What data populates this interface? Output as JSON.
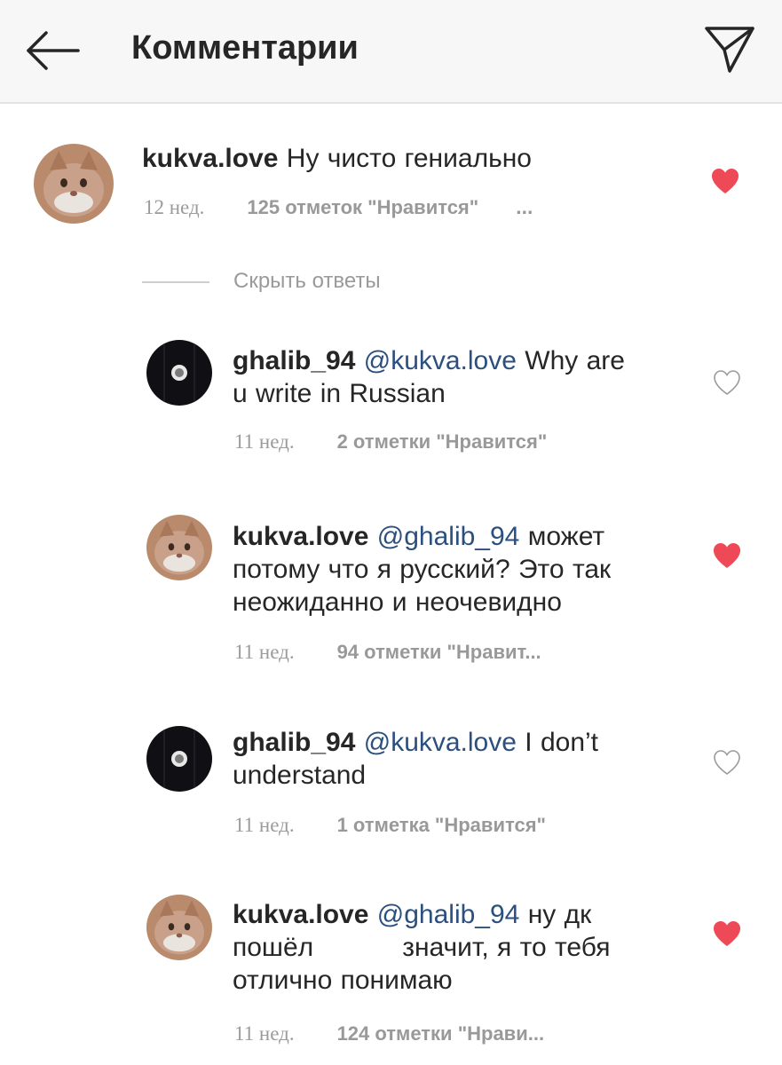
{
  "header": {
    "title": "Комментарии"
  },
  "colors": {
    "liked_heart": "#ed4956",
    "mention": "#2b4f7e",
    "meta": "#9b9b9b"
  },
  "main_comment": {
    "username": "kukva.love",
    "text": "Ну чисто гениально",
    "time": "12 нед.",
    "likes": "125 отметок \"Нравится\"",
    "more": "...",
    "liked": true
  },
  "hide_replies": "Скрыть ответы",
  "replies": [
    {
      "username": "ghalib_94",
      "mention": "@kukva.love",
      "line1_rest": "Why are",
      "line2": "u write in Russian",
      "time": "11 нед.",
      "likes": "2 отметки \"Нравится\"",
      "liked": false
    },
    {
      "username": "kukva.love",
      "mention": "@ghalib_94",
      "line1_rest": "может",
      "line2": "потому что я русский? Это так",
      "line3": "неожиданно и неочевидно",
      "time": "11 нед.",
      "likes": "94 отметки \"Нравит...",
      "liked": true
    },
    {
      "username": "ghalib_94",
      "mention": "@kukva.love",
      "line1_rest": "I don’t",
      "line2": "understand",
      "time": "11 нед.",
      "likes": "1 отметка \"Нравится\"",
      "liked": false
    },
    {
      "username": "kukva.love",
      "mention": "@ghalib_94",
      "line1_rest": "ну дк",
      "line2a": "пошёл",
      "line2b": "значит, я то тебя",
      "line3": "отлично понимаю",
      "time": "11 нед.",
      "likes": "124 отметки \"Нрави...",
      "liked": true
    }
  ]
}
